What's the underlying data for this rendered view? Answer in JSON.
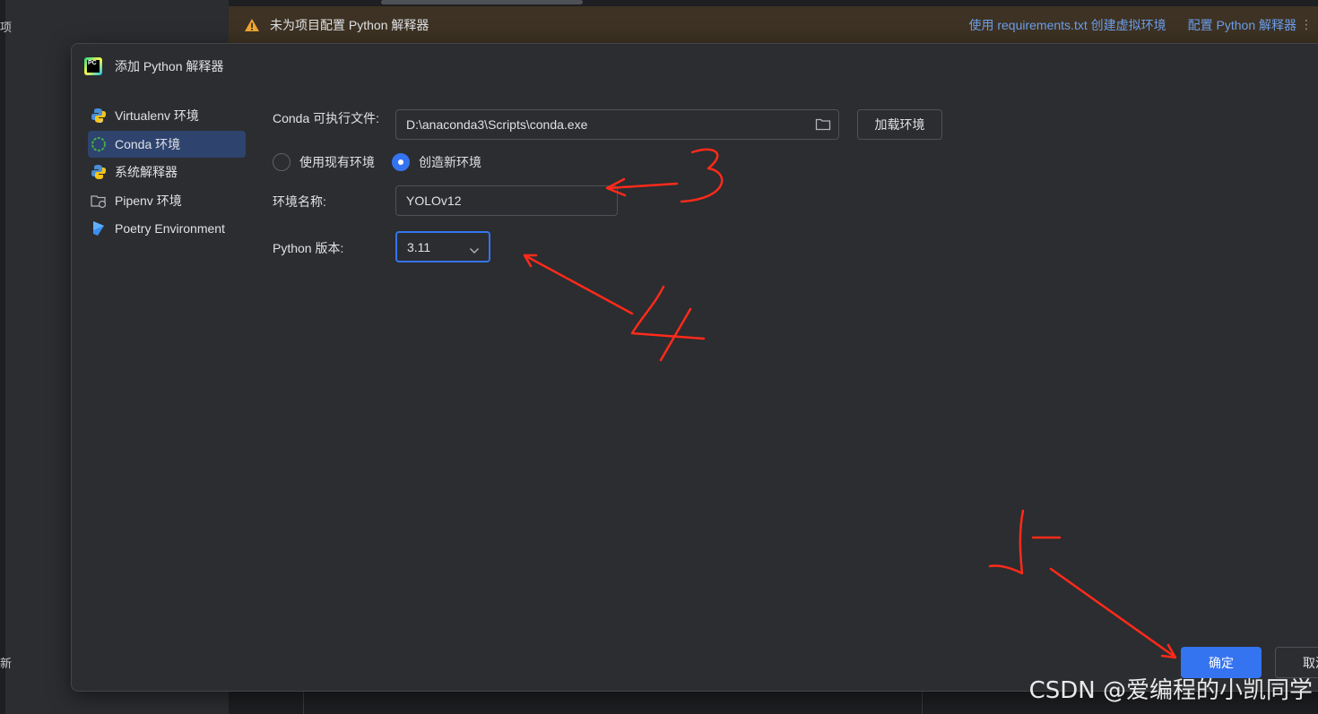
{
  "ide": {
    "left_glyph_top": "项",
    "left_glyph_bottom": "新"
  },
  "warning_bar": {
    "message": "未为项目配置 Python 解释器",
    "link_create_venv": "使用 requirements.txt 创建虚拟环境",
    "link_configure": "配置 Python 解释器",
    "more": "⋮"
  },
  "dialog": {
    "title": "添加 Python 解释器",
    "logo_text": "PC",
    "sidebar": {
      "items": [
        {
          "label": "Virtualenv 环境",
          "icon": "virtualenv-icon"
        },
        {
          "label": "Conda 环境",
          "icon": "conda-icon",
          "active": true
        },
        {
          "label": "系统解释器",
          "icon": "python-icon"
        },
        {
          "label": "Pipenv 环境",
          "icon": "pipenv-icon"
        },
        {
          "label": "Poetry Environment",
          "icon": "poetry-icon"
        }
      ]
    },
    "form": {
      "conda_label": "Conda 可执行文件:",
      "conda_path": "D:\\anaconda3\\Scripts\\conda.exe",
      "load_env_button": "加载环境",
      "radio_existing": "使用现有环境",
      "radio_new": "创造新环境",
      "selected_radio": "new",
      "env_name_label": "环境名称:",
      "env_name_value": "YOLOv12",
      "python_version_label": "Python 版本:",
      "python_version_value": "3.11"
    },
    "buttons": {
      "ok": "确定",
      "cancel": "取消"
    }
  },
  "annotations": {
    "color": "#ff2a1a",
    "labels": [
      "3",
      "4",
      "5"
    ]
  },
  "watermark": "CSDN @爱编程的小凯同学"
}
